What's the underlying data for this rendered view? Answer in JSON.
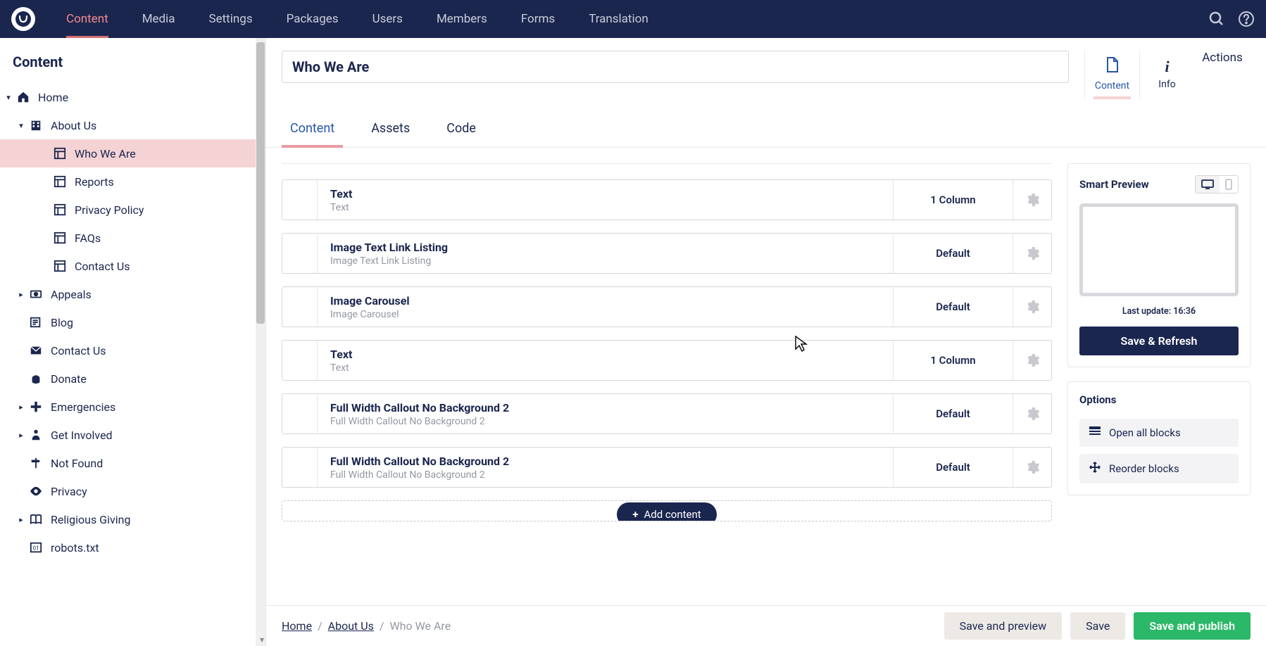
{
  "nav": {
    "items": [
      "Content",
      "Media",
      "Settings",
      "Packages",
      "Users",
      "Members",
      "Forms",
      "Translation"
    ]
  },
  "sidebar": {
    "title": "Content",
    "tree": [
      {
        "label": "Home",
        "level": 0,
        "icon": "home",
        "caret": true
      },
      {
        "label": "About Us",
        "level": 1,
        "icon": "building",
        "caret": true
      },
      {
        "label": "Who We Are",
        "level": 2,
        "icon": "layout",
        "active": true
      },
      {
        "label": "Reports",
        "level": 2,
        "icon": "layout"
      },
      {
        "label": "Privacy Policy",
        "level": 2,
        "icon": "layout"
      },
      {
        "label": "FAQs",
        "level": 2,
        "icon": "layout"
      },
      {
        "label": "Contact Us",
        "level": 2,
        "icon": "layout"
      },
      {
        "label": "Appeals",
        "level": 1,
        "icon": "money",
        "caret": true
      },
      {
        "label": "Blog",
        "level": 1,
        "icon": "news"
      },
      {
        "label": "Contact Us",
        "level": 1,
        "icon": "mail"
      },
      {
        "label": "Donate",
        "level": 1,
        "icon": "hands"
      },
      {
        "label": "Emergencies",
        "level": 1,
        "icon": "plus",
        "caret": true
      },
      {
        "label": "Get Involved",
        "level": 1,
        "icon": "person",
        "caret": true
      },
      {
        "label": "Not Found",
        "level": 1,
        "icon": "signpost"
      },
      {
        "label": "Privacy",
        "level": 1,
        "icon": "eye"
      },
      {
        "label": "Religious Giving",
        "level": 1,
        "icon": "book",
        "caret": true
      },
      {
        "label": "robots.txt",
        "level": 1,
        "icon": "binary"
      }
    ]
  },
  "page": {
    "title": "Who We Are",
    "rightTabs": {
      "content": "Content",
      "info": "Info",
      "actions": "Actions"
    },
    "contentTabs": [
      "Content",
      "Assets",
      "Code"
    ],
    "blocks": [
      {
        "title": "Text",
        "sub": "Text",
        "layout": "1 Column"
      },
      {
        "title": "Image Text Link Listing",
        "sub": "Image Text Link Listing",
        "layout": "Default"
      },
      {
        "title": "Image Carousel",
        "sub": "Image Carousel",
        "layout": "Default"
      },
      {
        "title": "Text",
        "sub": "Text",
        "layout": "1 Column"
      },
      {
        "title": "Full Width Callout No Background 2",
        "sub": "Full Width Callout No Background 2",
        "layout": "Default"
      },
      {
        "title": "Full Width Callout No Background 2",
        "sub": "Full Width Callout No Background 2",
        "layout": "Default"
      }
    ],
    "addContent": "Add content"
  },
  "smartPreview": {
    "title": "Smart Preview",
    "lastUpdate": "Last update: 16:36",
    "saveRefresh": "Save & Refresh"
  },
  "options": {
    "title": "Options",
    "openAll": "Open all blocks",
    "reorder": "Reorder blocks"
  },
  "footer": {
    "breadcrumb": [
      "Home",
      "About Us",
      "Who We Are"
    ],
    "savePreview": "Save and preview",
    "save": "Save",
    "savePublish": "Save and publish"
  }
}
